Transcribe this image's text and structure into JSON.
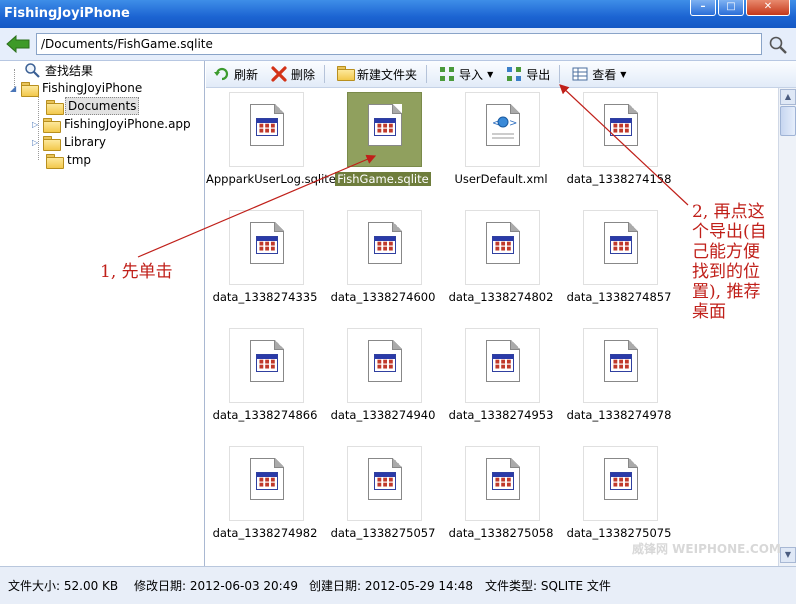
{
  "window": {
    "title": "FishingJoyiPhone"
  },
  "address": {
    "path": "/Documents/FishGame.sqlite"
  },
  "sidebar": {
    "search_label": "查找结果",
    "root_label": "FishingJoyiPhone",
    "items": [
      {
        "label": "Documents"
      },
      {
        "label": "FishingJoyiPhone.app"
      },
      {
        "label": "Library"
      },
      {
        "label": "tmp"
      }
    ]
  },
  "toolbar": {
    "refresh": "刷新",
    "delete": "删除",
    "new_folder": "新建文件夹",
    "import": "导入",
    "export": "导出",
    "view": "查看"
  },
  "files": [
    "AppparkUserLog.sqlite",
    "FishGame.sqlite",
    "UserDefault.xml",
    "data_1338274158",
    "data_1338274335",
    "data_1338274600",
    "data_1338274802",
    "data_1338274857",
    "data_1338274866",
    "data_1338274940",
    "data_1338274953",
    "data_1338274978",
    "data_1338274982",
    "data_1338275057",
    "data_1338275058",
    "data_1338275075"
  ],
  "selected_file_index": 1,
  "status": {
    "size": "文件大小: 52.00 KB",
    "modified": "修改日期: 2012-06-03 20:49",
    "created": "创建日期: 2012-05-29 14:48",
    "type": "文件类型: SQLITE 文件"
  },
  "annotations": {
    "step1": "1, 先单击",
    "step2_lines": [
      "2, 再点这",
      "个导出(自",
      "己能方便",
      "找到的位",
      "置), 推荐",
      "桌面"
    ]
  },
  "watermark": "威锋网 WEIPHONE.COM",
  "colors": {
    "titlebar": "#1c64d2",
    "selection": "#90a05e",
    "annotation": "#c0201a"
  }
}
